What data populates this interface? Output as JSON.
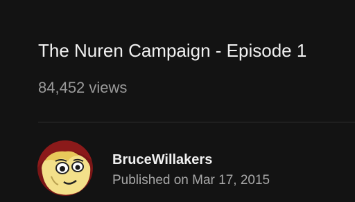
{
  "video": {
    "title": "The Nuren Campaign - Episode 1",
    "views": "84,452 views"
  },
  "channel": {
    "name": "BruceWillakers",
    "published": "Published on Mar 17, 2015",
    "avatar_icon": "cartoon-character-avatar"
  },
  "colors": {
    "background": "#131313",
    "title_text": "#f1f1f1",
    "secondary_text": "#9a9a9a",
    "divider": "#303030",
    "avatar_ring": "#8b1a1a",
    "avatar_skin": "#f3e08a"
  }
}
